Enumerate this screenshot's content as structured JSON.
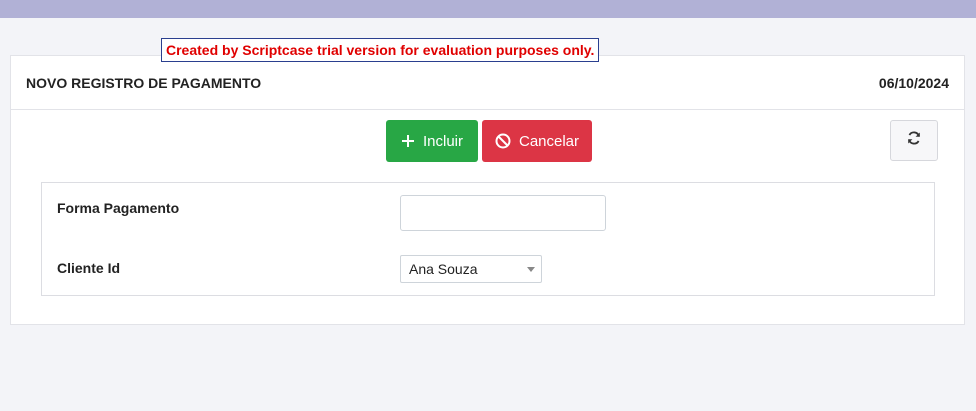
{
  "trial_notice": "Created by Scriptcase trial version for evaluation purposes only.",
  "header": {
    "title": "NOVO REGISTRO DE PAGAMENTO",
    "date": "06/10/2024"
  },
  "toolbar": {
    "incluir_label": "Incluir",
    "cancelar_label": "Cancelar",
    "incluir_color": "#28a745",
    "cancelar_color": "#dc3545",
    "icons": {
      "incluir": "plus-icon",
      "cancelar": "ban-icon",
      "refresh": "refresh-icon"
    }
  },
  "form": {
    "forma_pagamento": {
      "label": "Forma Pagamento",
      "value": ""
    },
    "cliente_id": {
      "label": "Cliente Id",
      "selected": "Ana Souza"
    }
  }
}
